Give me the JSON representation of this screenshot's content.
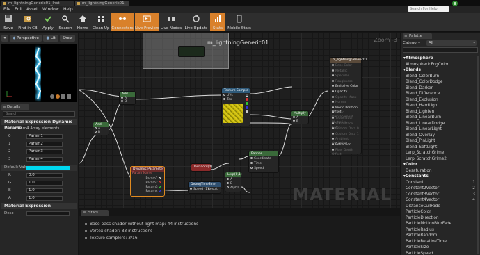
{
  "tabs": [
    {
      "label": "m_lightningGeneric01_Inst"
    },
    {
      "label": "m_lightningGeneric01"
    }
  ],
  "help_search": {
    "placeholder": "Search For Help"
  },
  "menu": [
    "File",
    "Edit",
    "Asset",
    "Window",
    "Help"
  ],
  "toolbar": [
    {
      "label": "Save",
      "icon": "save-icon",
      "active": false
    },
    {
      "label": "Find in CB",
      "icon": "find-in-content-browser-icon",
      "active": false
    },
    {
      "label": "Apply",
      "icon": "apply-icon",
      "active": false
    },
    {
      "label": "Search",
      "icon": "search-icon",
      "active": false
    },
    {
      "label": "Home",
      "icon": "home-icon",
      "active": false
    },
    {
      "label": "Clean Up",
      "icon": "clean-up-icon",
      "active": false
    },
    {
      "label": "Connectors",
      "icon": "connectors-icon",
      "active": true
    },
    {
      "label": "Live Preview",
      "icon": "live-preview-icon",
      "active": true
    },
    {
      "label": "Live Nodes",
      "icon": "live-nodes-icon",
      "active": false
    },
    {
      "label": "Live Update",
      "icon": "live-update-icon",
      "active": false
    },
    {
      "label": "Stats",
      "icon": "stats-icon",
      "active": true
    },
    {
      "label": "Mobile Stats",
      "icon": "mobile-stats-icon",
      "active": false
    }
  ],
  "viewport": {
    "perspective_label": "Perspective",
    "lit_label": "Lit",
    "show_label": "Show"
  },
  "details": {
    "tab_label": "Details",
    "search_placeholder": "Search",
    "section_title": "Material Expression Dynamic Parame",
    "param_names_label": "Param Nam",
    "param_names_value": "4 Array elements",
    "params": [
      {
        "index": "0",
        "value": "Param1"
      },
      {
        "index": "1",
        "value": "Param2"
      },
      {
        "index": "2",
        "value": "Param3"
      },
      {
        "index": "3",
        "value": "Param4"
      }
    ],
    "default_value_label": "Default Valu",
    "default_color": "#00d8f0",
    "channels": [
      {
        "name": "R",
        "value": "0.0"
      },
      {
        "name": "G",
        "value": "1.0"
      },
      {
        "name": "B",
        "value": "1.0"
      },
      {
        "name": "A",
        "value": "1.0"
      }
    ],
    "expression_section_title": "Material Expression",
    "desc_label": "Desc"
  },
  "graph": {
    "zoom": "Zoom -3",
    "watermark": "MATERIAL",
    "comment_title": "m_lightningGeneric01",
    "nodes": {
      "result": {
        "title": "m_lightningGeneric01",
        "pins": [
          "Base Color",
          "Metallic",
          "Specular",
          "Roughness",
          "Emissive Color",
          "Opacity",
          "Opacity Mask",
          "Normal",
          "World Position Offset",
          "World Displacement",
          "Tessellation Multiplier",
          "Subsurface Color",
          "Custom Data 0",
          "Custom Data 1",
          "Ambient Occlusion",
          "Refraction",
          "Pixel Depth Offset"
        ]
      },
      "add1": {
        "title": "Add"
      },
      "add2": {
        "title": "Add"
      },
      "texture": {
        "title": "Texture Sample",
        "pins": [
          "UVs",
          "Tex"
        ]
      },
      "multiply": {
        "title": "Multiply"
      },
      "panner": {
        "title": "Panner",
        "pins": [
          "Coordinate",
          "Time",
          "Speed"
        ]
      },
      "dynparam": {
        "title": "Dynamic Parameter",
        "subtitle": "Param Name",
        "pins": [
          "Param1",
          "Param2",
          "Param3",
          "Param4"
        ]
      },
      "texcoord": {
        "title": "TexCoord[0]"
      },
      "lerp": {
        "title": "Lerp(0,1)",
        "pins": [
          "Alpha"
        ]
      },
      "debug": {
        "title": "DebugTimeSine",
        "pins": [
          "Speed (1)",
          "Result"
        ]
      }
    }
  },
  "stats": {
    "tab_label": "Stats",
    "lines": [
      "Base pass shader without light map: 44 instructions",
      "Vertex shader: 83 instructions",
      "Texture samplers: 3/16"
    ]
  },
  "palette": {
    "tab_label": "Palette",
    "category_label": "Category",
    "category_value": "All",
    "search_placeholder": "",
    "items": [
      {
        "text": "Atmosphere",
        "header": true,
        "num": ""
      },
      {
        "text": "AtmosphericFogColor",
        "header": false,
        "num": ""
      },
      {
        "text": "Blends",
        "header": true,
        "num": ""
      },
      {
        "text": "Blend_ColorBurn",
        "header": false,
        "num": ""
      },
      {
        "text": "Blend_ColorDodge",
        "header": false,
        "num": ""
      },
      {
        "text": "Blend_Darken",
        "header": false,
        "num": ""
      },
      {
        "text": "Blend_Difference",
        "header": false,
        "num": ""
      },
      {
        "text": "Blend_Exclusion",
        "header": false,
        "num": ""
      },
      {
        "text": "Blend_HardLight",
        "header": false,
        "num": ""
      },
      {
        "text": "Blend_Lighten",
        "header": false,
        "num": ""
      },
      {
        "text": "Blend_LinearBurn",
        "header": false,
        "num": ""
      },
      {
        "text": "Blend_LinearDodge",
        "header": false,
        "num": ""
      },
      {
        "text": "Blend_LinearLight",
        "header": false,
        "num": ""
      },
      {
        "text": "Blend_Overlay",
        "header": false,
        "num": ""
      },
      {
        "text": "Blend_PinLight",
        "header": false,
        "num": ""
      },
      {
        "text": "Blend_SoftLight",
        "header": false,
        "num": ""
      },
      {
        "text": "Lerp_ScratchGrime",
        "header": false,
        "num": ""
      },
      {
        "text": "Lerp_ScratchGrime2",
        "header": false,
        "num": ""
      },
      {
        "text": "Color",
        "header": true,
        "num": ""
      },
      {
        "text": "Desaturation",
        "header": false,
        "num": ""
      },
      {
        "text": "Constants",
        "header": true,
        "num": ""
      },
      {
        "text": "Constant",
        "header": false,
        "num": "1"
      },
      {
        "text": "Constant2Vector",
        "header": false,
        "num": "2"
      },
      {
        "text": "Constant3Vector",
        "header": false,
        "num": "3"
      },
      {
        "text": "Constant4Vector",
        "header": false,
        "num": "4"
      },
      {
        "text": "DistanceCullFade",
        "header": false,
        "num": ""
      },
      {
        "text": "ParticleColor",
        "header": false,
        "num": ""
      },
      {
        "text": "ParticleDirection",
        "header": false,
        "num": ""
      },
      {
        "text": "ParticleMotionBlurFade",
        "header": false,
        "num": ""
      },
      {
        "text": "ParticleRadius",
        "header": false,
        "num": ""
      },
      {
        "text": "ParticleRandom",
        "header": false,
        "num": ""
      },
      {
        "text": "ParticleRelativeTime",
        "header": false,
        "num": ""
      },
      {
        "text": "ParticleSize",
        "header": false,
        "num": ""
      },
      {
        "text": "ParticleSpeed",
        "header": false,
        "num": ""
      }
    ]
  }
}
